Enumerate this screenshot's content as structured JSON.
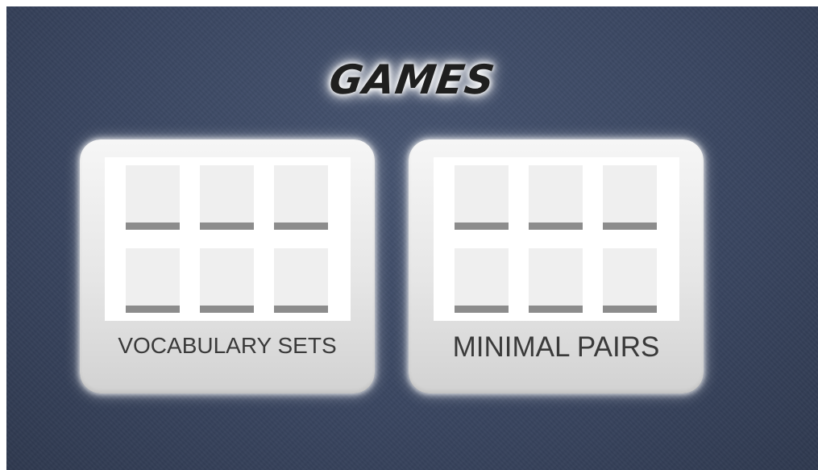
{
  "header": {
    "title": "GAMES"
  },
  "games": [
    {
      "label": "VOCABULARY SETS",
      "preview_tiles": 6
    },
    {
      "label": "MINIMAL PAIRS",
      "preview_tiles": 6
    }
  ],
  "colors": {
    "background": "#3a4661",
    "card": "#e6e6e6",
    "tile": "#efefef",
    "tile_bar": "#8c8c8c",
    "label_text": "#3a3a3a",
    "title_text": "#1f1f1f"
  }
}
